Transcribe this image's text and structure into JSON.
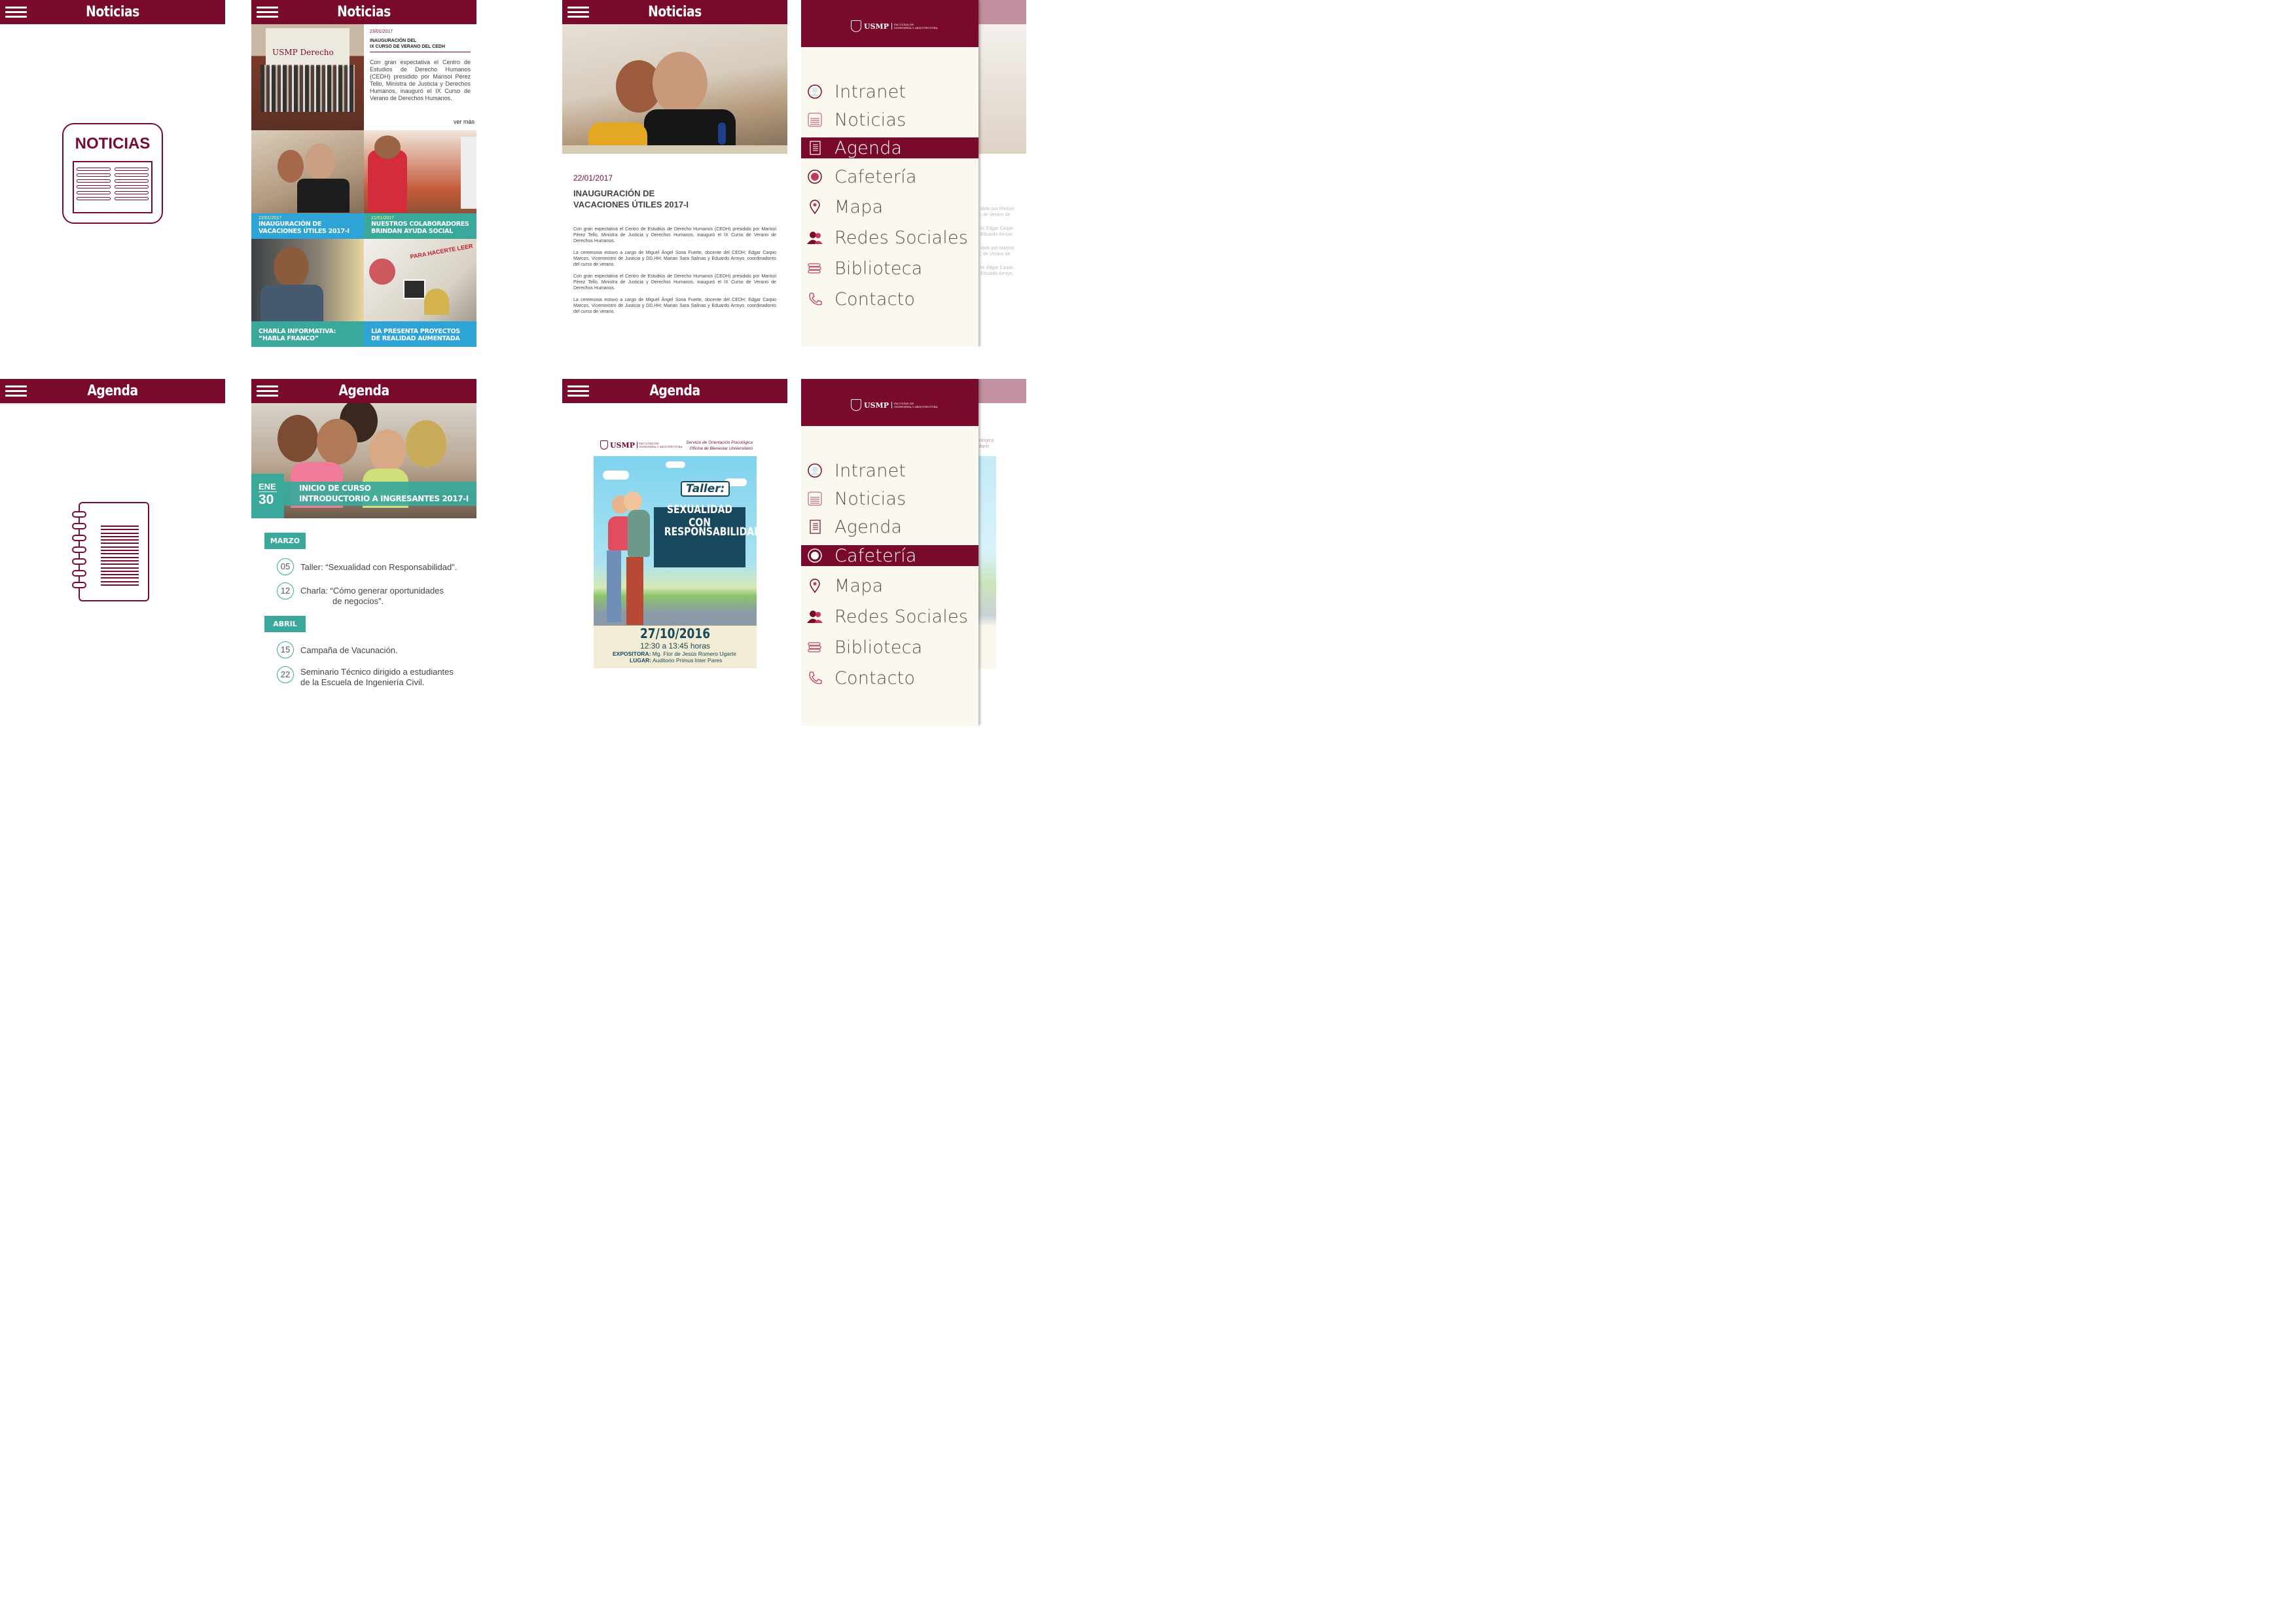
{
  "colors": {
    "brand": "#7a0a2c",
    "teal": "#3aa89a",
    "blue": "#2ea3d6",
    "drawer_bg": "#fbf8f0"
  },
  "screens": {
    "noticias_splash": {
      "title": "Noticias",
      "icon_label": "NOTICIAS"
    },
    "noticias_list": {
      "title": "Noticias",
      "featured": {
        "date": "23/01/2017",
        "title_line1": "INAUGURACIÓN DEL",
        "title_line2": "IX CURSO DE VERANO DEL CEDH",
        "body": "Con gran expectativa el Centro de Estudios de Derecho Humanos (CEDH) presidido por Marisol Pérez Tello, Ministra de Justicia y Derechos Humanos, inauguró el IX Curso de Verano de Derechos Humanos.",
        "more": "ver más",
        "photo_sign": "USMP Derecho"
      },
      "tiles": [
        {
          "date": "22/01/2017",
          "line1": "INAUGURACIÓN DE",
          "line2": "VACACIONES ÚTILES 2017-I"
        },
        {
          "date": "21/01/2017",
          "line1": "NUESTROS COLABORADORES",
          "line2": "BRINDAN AYUDA SOCIAL"
        },
        {
          "date": "",
          "line1": "CHARLA INFORMATIVA:",
          "line2": "“HABLA FRANCO”"
        },
        {
          "date": "",
          "line1": "LIA PRESENTA PROYECTOS",
          "line2": "DE REALIDAD AUMENTADA"
        }
      ],
      "tile_photo_text": "PARA HACERTE LEER"
    },
    "noticias_detail": {
      "title": "Noticias",
      "date": "22/01/2017",
      "headline_line1": "INAUGURACIÓN DE",
      "headline_line2": "VACACIONES ÚTILES 2017-I",
      "paragraphs": [
        "Con gran expectativa el Centro de Estudios de Derecho Humanos (CEDH) presidido por Marisol Pérez Tello, Ministra de Justicia y Derechos Humanos, inauguró el IX Curso de Verano de Derechos Humanos.",
        "La ceremonia estuvo a cargo de Miguel Ángel Soria Fuerte, docente del CEDH; Edgar Carpio Marcos, Viceministro de Justicia y DD.HH; Marian Sara Salinas y Eduardo Arroyo, coordinadores del curso de verano.",
        "Con gran expectativa el Centro de Estudios de Derecho Humanos (CEDH) presidido por Marisol Pérez Tello, Ministra de Justicia y Derechos Humanos, inauguró el IX Curso de Verano de Derechos Humanos.",
        "La ceremonia estuvo a cargo de Miguel Ángel Soria Fuerte, docente del CEDH; Edgar Carpio Marcos, Viceministro de Justicia y DD.HH; Marian Sara Salinas y Eduardo Arroyo, coordinadores del curso de verano."
      ]
    },
    "drawer": {
      "logo_text": "USMP",
      "logo_sub_line1": "FACULTAD DE",
      "logo_sub_line2": "INGENIERÍA Y ARQUITECTURA",
      "items": [
        {
          "label": "Intranet",
          "icon": "user-icon"
        },
        {
          "label": "Noticias",
          "icon": "newspaper-icon"
        },
        {
          "label": "Agenda",
          "icon": "notebook-icon"
        },
        {
          "label": "Cafetería",
          "icon": "plate-icon"
        },
        {
          "label": "Mapa",
          "icon": "map-pin-icon"
        },
        {
          "label": "Redes Sociales",
          "icon": "people-icon"
        },
        {
          "label": "Biblioteca",
          "icon": "books-icon"
        },
        {
          "label": "Contacto",
          "icon": "phone-icon"
        }
      ],
      "active_top": "Agenda",
      "active_bottom": "Cafetería",
      "peek_top": [
        "idido por Marisol",
        "; de Verano de",
        "H; Edgar Carpio",
        "Eduardo Arroyo,",
        "idido por Marisol",
        "; de Verano de",
        "H; Edgar Carpio",
        "Eduardo Arroyo,"
      ],
      "peek_bottom": [
        "ológica",
        "itario"
      ]
    },
    "agenda_splash": {
      "title": "Agenda"
    },
    "agenda_list": {
      "title": "Agenda",
      "banner": {
        "month": "ENE",
        "day": "30",
        "line1": "INICIO DE CURSO",
        "line2": "INTRODUCTORIO A INGRESANTES 2017-I"
      },
      "months": [
        {
          "name": "MARZO",
          "events": [
            {
              "day": "05",
              "text": "Taller: “Sexualidad con Responsabilidad”.",
              "text2": ""
            },
            {
              "day": "12",
              "text": "Charla: “Cómo generar oportunidades",
              "text2": "de negocios”."
            }
          ]
        },
        {
          "name": "ABRIL",
          "events": [
            {
              "day": "15",
              "text": "Campaña de Vacunación.",
              "text2": ""
            },
            {
              "day": "22",
              "text": "Seminario Técnico dirigido a estudiantes",
              "text2": "de la Escuela de Ingeniería Civil."
            }
          ]
        }
      ]
    },
    "agenda_detail": {
      "title": "Agenda",
      "poster": {
        "logo": "USMP",
        "logo_sub_line1": "FACULTAD DE",
        "logo_sub_line2": "INGENIERÍA Y ARQUITECTURA",
        "org_line1": "Servicio de Orientación Psicológica",
        "org_line2": "Oficina de Bienestar Universitario",
        "taller": "Taller:",
        "headline_line1": "SEXUALIDAD CON",
        "headline_line2": "RESPONSABILIDAD",
        "date": "27/10/2016",
        "time": "12:30 a 13:45 horas",
        "expositora_label": "EXPOSITORA:",
        "expositora": "Mg. Flor de Jesús Romero Ugarte",
        "lugar_label": "LUGAR:",
        "lugar": "Auditorio Primus Inter Pares"
      }
    }
  }
}
